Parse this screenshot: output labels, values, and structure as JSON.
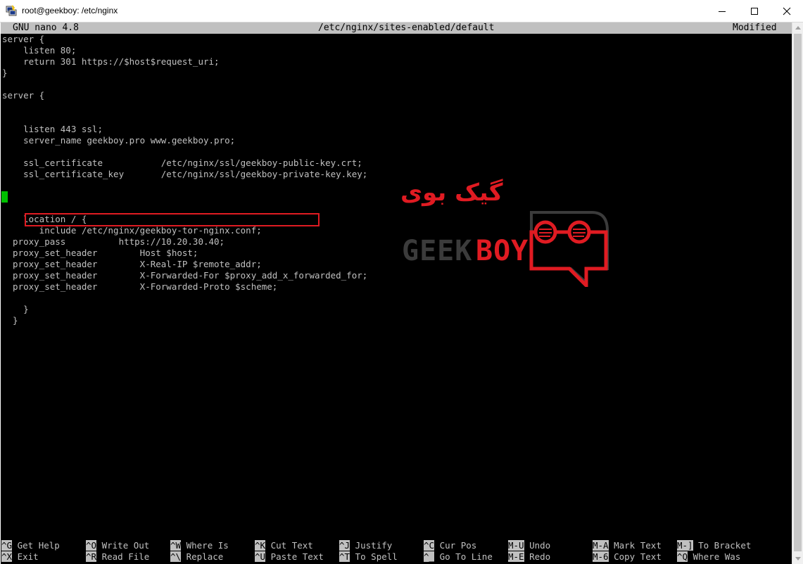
{
  "window": {
    "title": "root@geekboy: /etc/nginx",
    "icon": "putty-icon",
    "controls": [
      "minimize-icon",
      "maximize-icon",
      "close-icon"
    ]
  },
  "nano": {
    "version": "GNU nano 4.8",
    "filename": "/etc/nginx/sites-enabled/default",
    "status": "Modified"
  },
  "code_lines": [
    "server {",
    "    listen 80;",
    "    return 301 https://$host$request_uri;",
    "}",
    "",
    "server {",
    "",
    "",
    "    listen 443 ssl;",
    "    server_name geekboy.pro www.geekboy.pro;",
    "",
    "    ssl_certificate           /etc/nginx/ssl/geekboy-public-key.crt;",
    "    ssl_certificate_key       /etc/nginx/ssl/geekboy-private-key.key;",
    "",
    "",
    "",
    "    location / {",
    "       include /etc/nginx/geekboy-tor-nginx.conf;",
    "  proxy_pass          https://10.20.30.40;",
    "  proxy_set_header        Host $host;",
    "  proxy_set_header        X-Real-IP $remote_addr;",
    "  proxy_set_header        X-Forwarded-For $proxy_add_x_forwarded_for;",
    "  proxy_set_header        X-Forwarded-Proto $scheme;",
    "",
    "    }",
    "  }"
  ],
  "shortcuts": {
    "row1": [
      {
        "key": "^G",
        "label": "Get Help"
      },
      {
        "key": "^O",
        "label": "Write Out"
      },
      {
        "key": "^W",
        "label": "Where Is"
      },
      {
        "key": "^K",
        "label": "Cut Text"
      },
      {
        "key": "^J",
        "label": "Justify"
      },
      {
        "key": "^C",
        "label": "Cur Pos"
      },
      {
        "key": "M-U",
        "label": "Undo"
      },
      {
        "key": "M-A",
        "label": "Mark Text"
      },
      {
        "key": "M-]",
        "label": "To Bracket"
      }
    ],
    "row2": [
      {
        "key": "^X",
        "label": "Exit"
      },
      {
        "key": "^R",
        "label": "Read File"
      },
      {
        "key": "^\\",
        "label": "Replace"
      },
      {
        "key": "^U",
        "label": "Paste Text"
      },
      {
        "key": "^T",
        "label": "To Spell"
      },
      {
        "key": "^_",
        "label": "Go To Line"
      },
      {
        "key": "M-E",
        "label": "Redo"
      },
      {
        "key": "M-6",
        "label": "Copy Text"
      },
      {
        "key": "^Q",
        "label": "Where Was"
      }
    ]
  },
  "watermark": {
    "persian": "گیک بوی",
    "geek": "GEEK",
    "boy": "BOY"
  },
  "colors": {
    "terminal_bg": "#000000",
    "terminal_fg": "#c0c0c0",
    "header_bg": "#c0c0c0",
    "cursor": "#00c000",
    "accent_red": "#e01b22"
  }
}
